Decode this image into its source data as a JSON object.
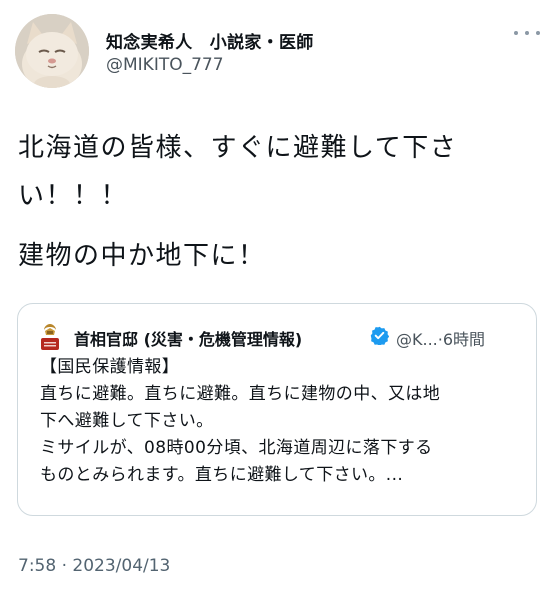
{
  "author": {
    "display_name": "知念実希人　小説家・医師",
    "handle": "@MIKITO_777"
  },
  "tweet": {
    "lines": [
      "北海道の皆様、すぐに避難して下さ",
      "い！！！",
      "建物の中か地下に！"
    ]
  },
  "quoted_tweet": {
    "author_name": "首相官邸 (災害・危機管理情報)",
    "handle_time": "@K...·6時間",
    "lines": [
      "【国民保護情報】",
      "直ちに避難。直ちに避難。直ちに建物の中、又は地",
      "下へ避難して下さい。",
      "ミサイルが、08時00分頃、北海道周辺に落下する",
      "ものとみられます。直ちに避難して下さい。..."
    ]
  },
  "timestamp": "7:58 · 2023/04/13",
  "icons": {
    "avatar": "cat-avatar",
    "more": "more-options-icon",
    "verified": "verified-badge-icon",
    "quote_avatar": "government-emblem-icon"
  },
  "colors": {
    "verified_blue": "#1d9bf0",
    "emblem_red": "#b5281f",
    "emblem_gold": "#b8862b"
  }
}
